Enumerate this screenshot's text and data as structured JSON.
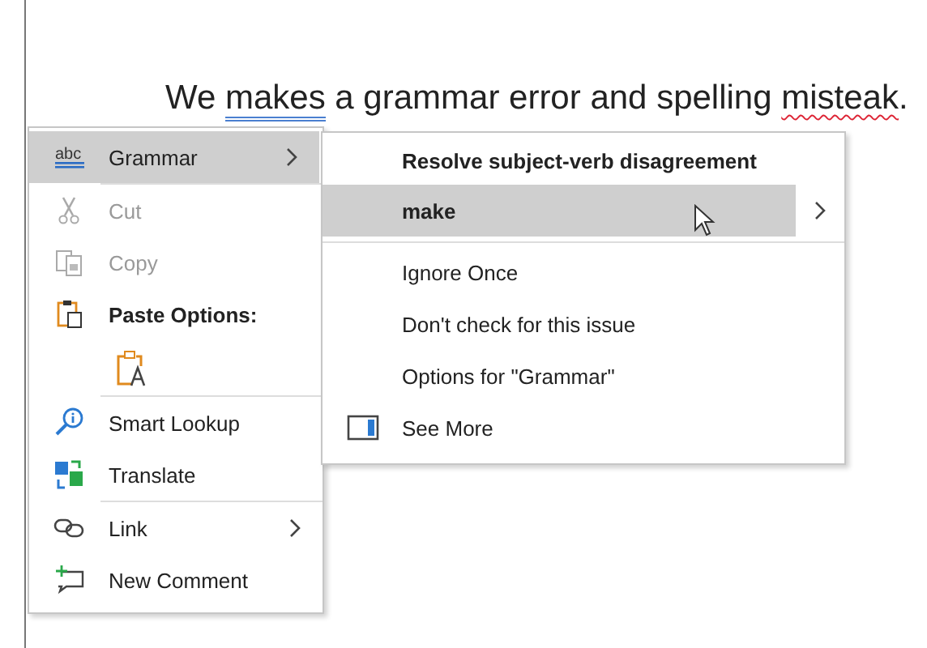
{
  "document": {
    "sentence": [
      {
        "text": "We ",
        "grammar_error": false,
        "spelling_error": false
      },
      {
        "text": "makes",
        "grammar_error": true,
        "spelling_error": false
      },
      {
        "text": " a grammar error and spelling ",
        "grammar_error": false,
        "spelling_error": false
      },
      {
        "text": "misteak",
        "grammar_error": false,
        "spelling_error": true
      },
      {
        "text": ".",
        "grammar_error": false,
        "spelling_error": false
      }
    ]
  },
  "context_menu": {
    "groups": [
      [
        {
          "kind": "command",
          "icon_text": "abc",
          "label": "Grammar",
          "disabled": false,
          "selected": true,
          "submenu": true
        }
      ],
      [
        {
          "kind": "command",
          "label": "Cut",
          "disabled": true,
          "selected": false,
          "submenu": false
        },
        {
          "kind": "command",
          "label": "Copy",
          "disabled": true,
          "selected": false,
          "submenu": false
        },
        {
          "kind": "heading",
          "label": "Paste Options:"
        },
        {
          "kind": "paste-option"
        }
      ],
      [
        {
          "kind": "command",
          "label": "Smart Lookup",
          "disabled": false,
          "selected": false,
          "submenu": false
        },
        {
          "kind": "command",
          "label": "Translate",
          "disabled": false,
          "selected": false,
          "submenu": false
        }
      ],
      [
        {
          "kind": "command",
          "label": "Link",
          "disabled": false,
          "selected": false,
          "submenu": true
        },
        {
          "kind": "command",
          "label": "New Comment",
          "disabled": false,
          "selected": false,
          "submenu": false
        }
      ]
    ]
  },
  "submenu": {
    "groups": [
      [
        {
          "kind": "heading",
          "label": "Resolve subject-verb disagreement"
        },
        {
          "kind": "suggestion",
          "label": "make",
          "disabled": false,
          "selected": true,
          "submenu": true
        }
      ],
      [
        {
          "kind": "command",
          "label": "Ignore Once",
          "disabled": false,
          "selected": false,
          "submenu": false
        },
        {
          "kind": "command",
          "label": "Don't check for this issue",
          "disabled": false,
          "selected": false,
          "submenu": false
        },
        {
          "kind": "command",
          "label": "Options for \"Grammar\"",
          "disabled": false,
          "selected": false,
          "submenu": false
        },
        {
          "kind": "command",
          "label": "See More",
          "disabled": false,
          "selected": false,
          "submenu": false
        }
      ]
    ]
  }
}
